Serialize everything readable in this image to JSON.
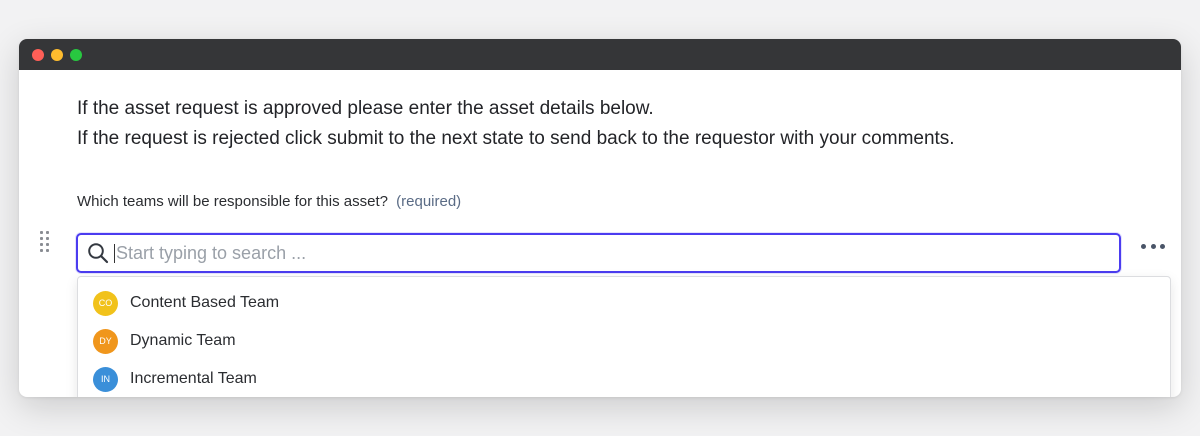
{
  "window": {
    "traffic_lights": [
      {
        "name": "close",
        "color": "#ff5f57"
      },
      {
        "name": "minimize",
        "color": "#febc2e"
      },
      {
        "name": "zoom",
        "color": "#28c840"
      }
    ]
  },
  "form": {
    "instructions": [
      "If the asset request is approved please enter the asset details below.",
      "If the request is rejected click submit to the next state to send back to the requestor with your comments."
    ],
    "question_label": "Which teams will be responsible for this asset?",
    "required_label": "(required)",
    "search": {
      "placeholder": "Start typing to search ...",
      "value": "",
      "icon": "search-icon"
    },
    "more_icon": "more-horizontal-icon",
    "drag_icon": "drag-handle-icon",
    "accent_color": "#4b3cf0",
    "options": [
      {
        "initials": "CO",
        "label": "Content Based Team",
        "color": "#f1c21b"
      },
      {
        "initials": "DY",
        "label": "Dynamic Team",
        "color": "#f0961c"
      },
      {
        "initials": "IN",
        "label": "Incremental Team",
        "color": "#3a8fd9"
      }
    ]
  }
}
